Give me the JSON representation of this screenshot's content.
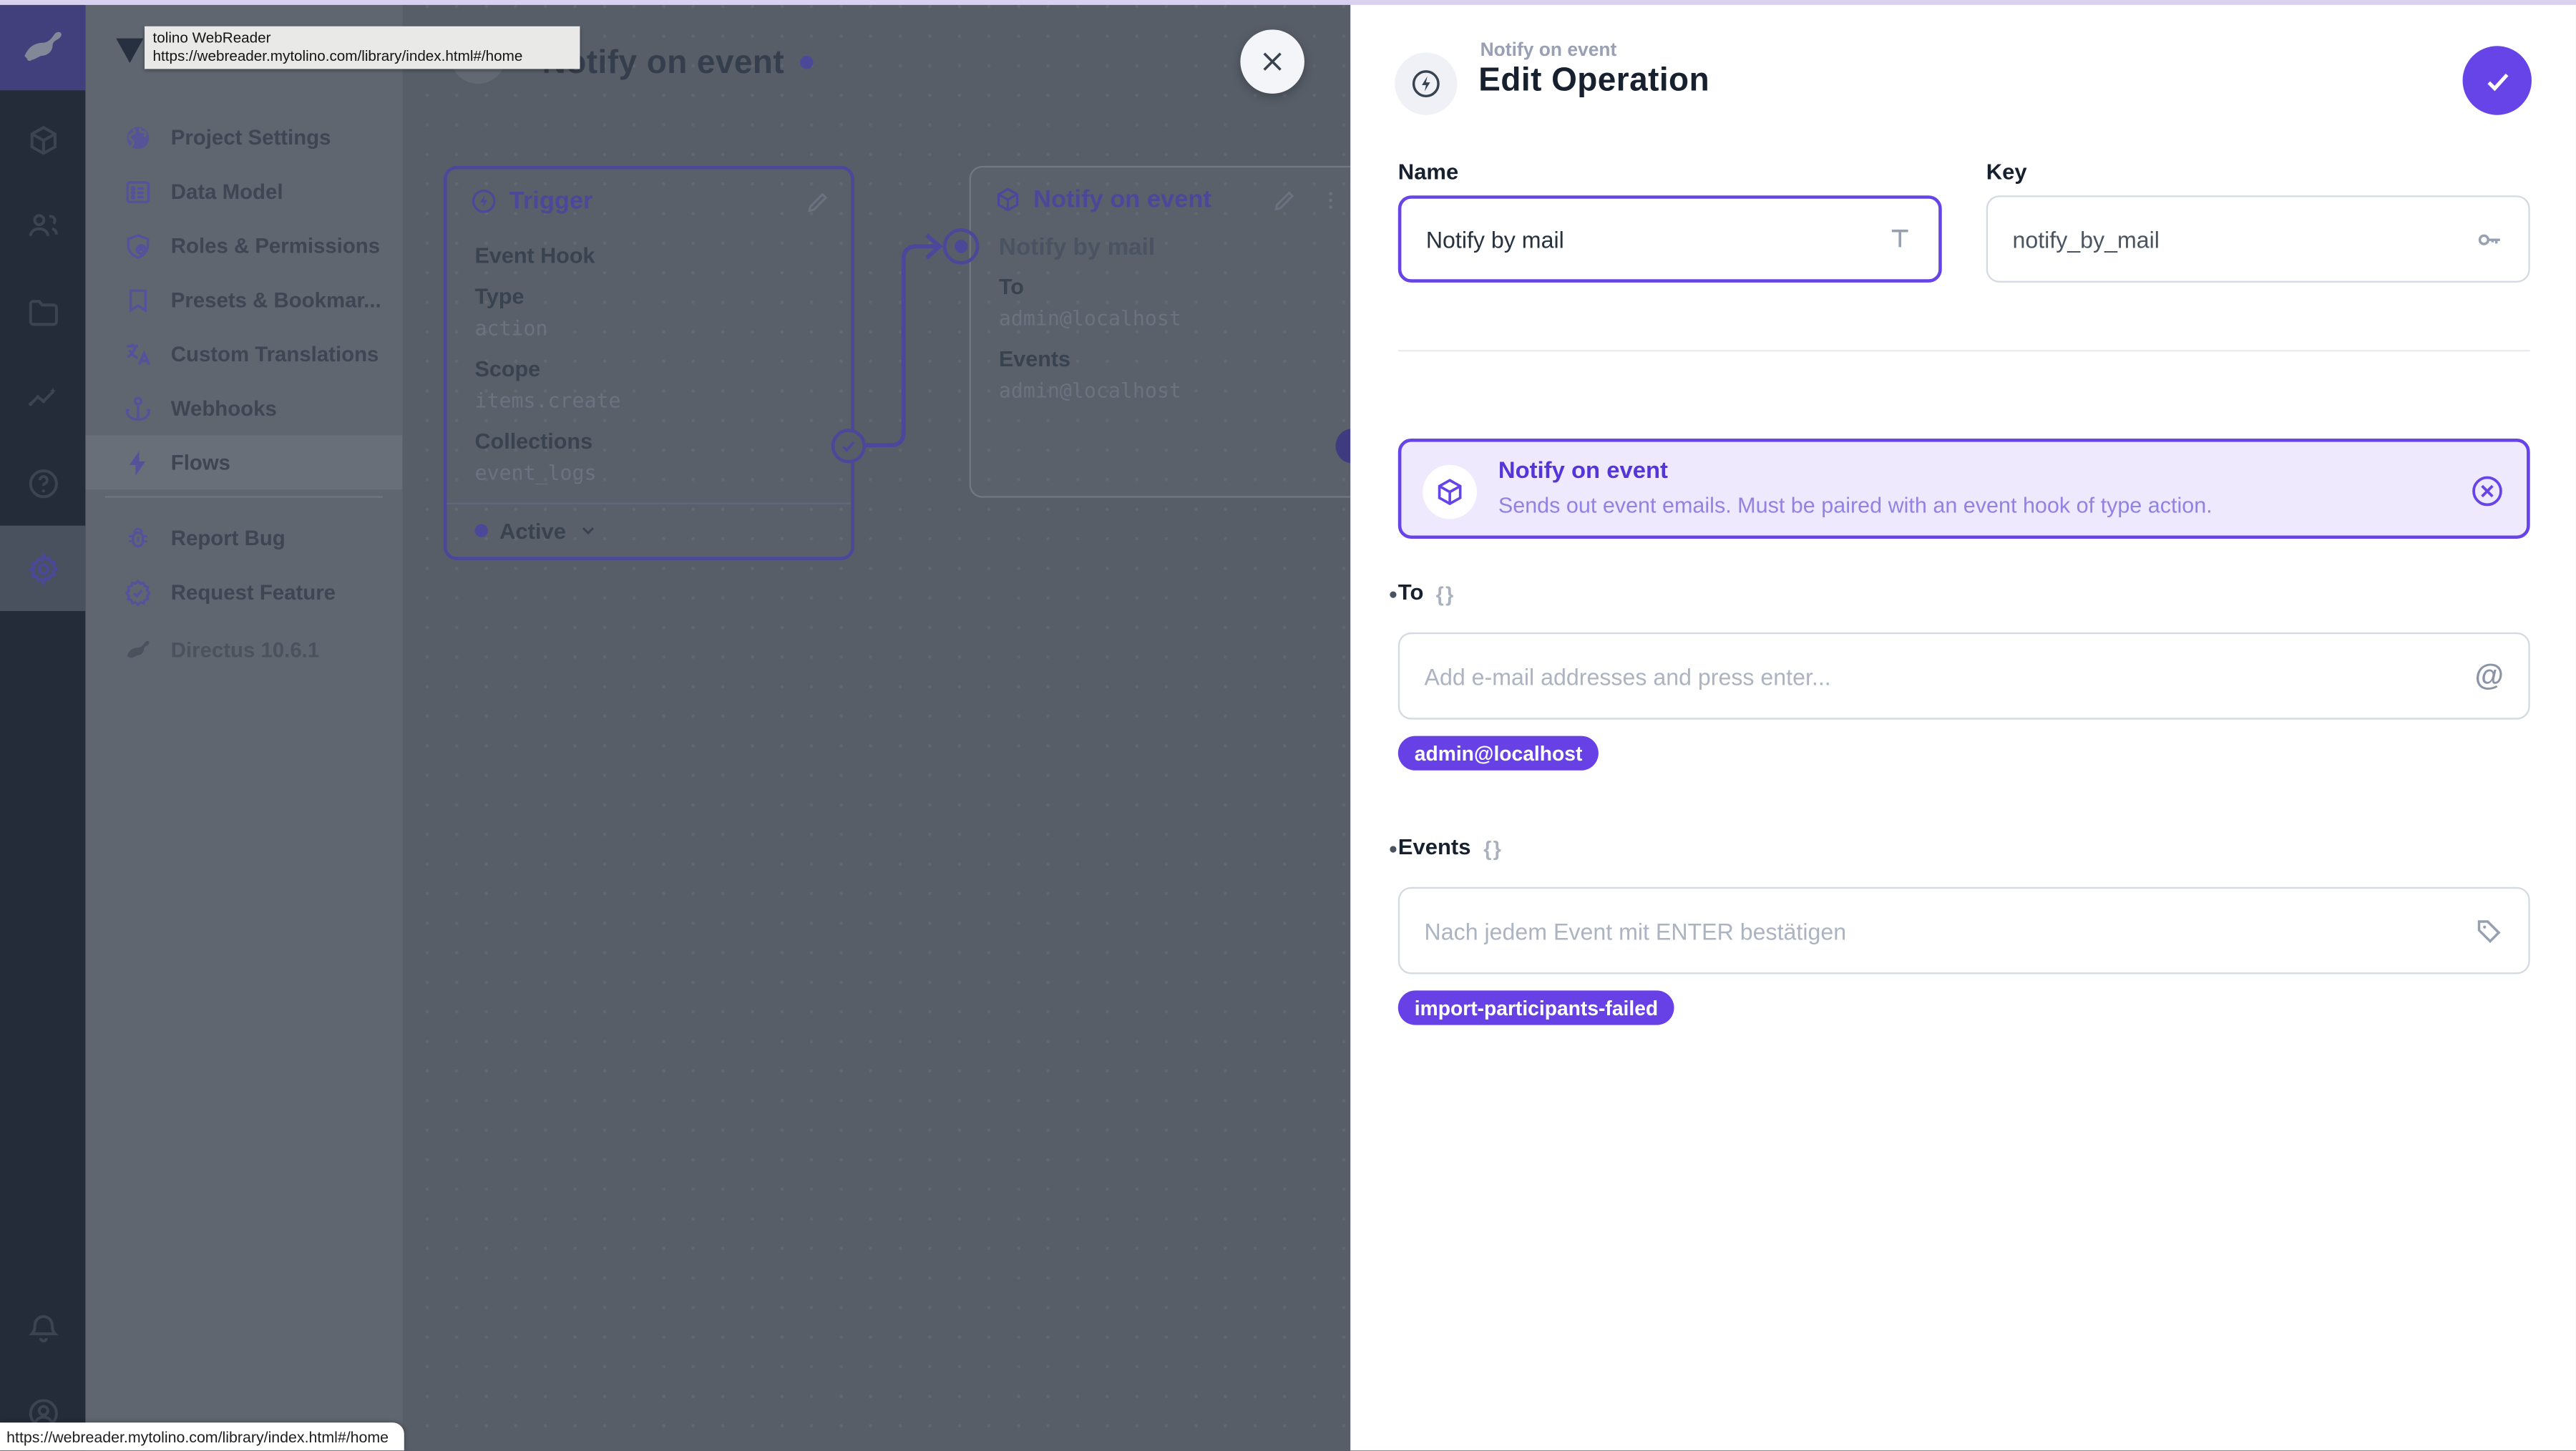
{
  "browser_tooltip": {
    "title": "tolino WebReader",
    "url": "https://webreader.mytolino.com/library/index.html#/home"
  },
  "statusbar": {
    "url": "https://webreader.mytolino.com/library/index.html#/home"
  },
  "navigation": {
    "items": [
      {
        "label": "Project Settings"
      },
      {
        "label": "Data Model"
      },
      {
        "label": "Roles & Permissions"
      },
      {
        "label": "Presets & Bookmar..."
      },
      {
        "label": "Custom Translations"
      },
      {
        "label": "Webhooks"
      },
      {
        "label": "Flows"
      }
    ],
    "footer_items": [
      {
        "label": "Report Bug"
      },
      {
        "label": "Request Feature"
      }
    ],
    "version": "Directus 10.6.1"
  },
  "canvas": {
    "title": "Notify on event",
    "trigger_card": {
      "title": "Trigger",
      "subtitle": "Event Hook",
      "fields": [
        {
          "label": "Type",
          "value": "action"
        },
        {
          "label": "Scope",
          "value": "items.create"
        },
        {
          "label": "Collections",
          "value": "event_logs"
        }
      ],
      "status": "Active"
    },
    "operation_card": {
      "title": "Notify on event",
      "name": "Notify by mail",
      "fields": [
        {
          "label": "To",
          "value": "admin@localhost"
        },
        {
          "label": "Events",
          "value": "admin@localhost"
        }
      ]
    }
  },
  "drawer": {
    "breadcrumb": "Notify on event",
    "title": "Edit Operation",
    "name_field": {
      "label": "Name",
      "value": "Notify by mail"
    },
    "key_field": {
      "label": "Key",
      "value": "notify_by_mail"
    },
    "panel_info": {
      "title": "Notify on event",
      "description": "Sends out event emails. Must be paired with an event hook of type action."
    },
    "to_field": {
      "label": "To",
      "placeholder": "Add e-mail addresses and press enter...",
      "chips": [
        "admin@localhost"
      ]
    },
    "events_field": {
      "label": "Events",
      "placeholder": "Nach jedem Event mit ENTER bestätigen",
      "chips": [
        "import-participants-failed"
      ]
    },
    "braces_icon": "{}",
    "at_icon": "@",
    "accent_color": "#6644E8"
  }
}
